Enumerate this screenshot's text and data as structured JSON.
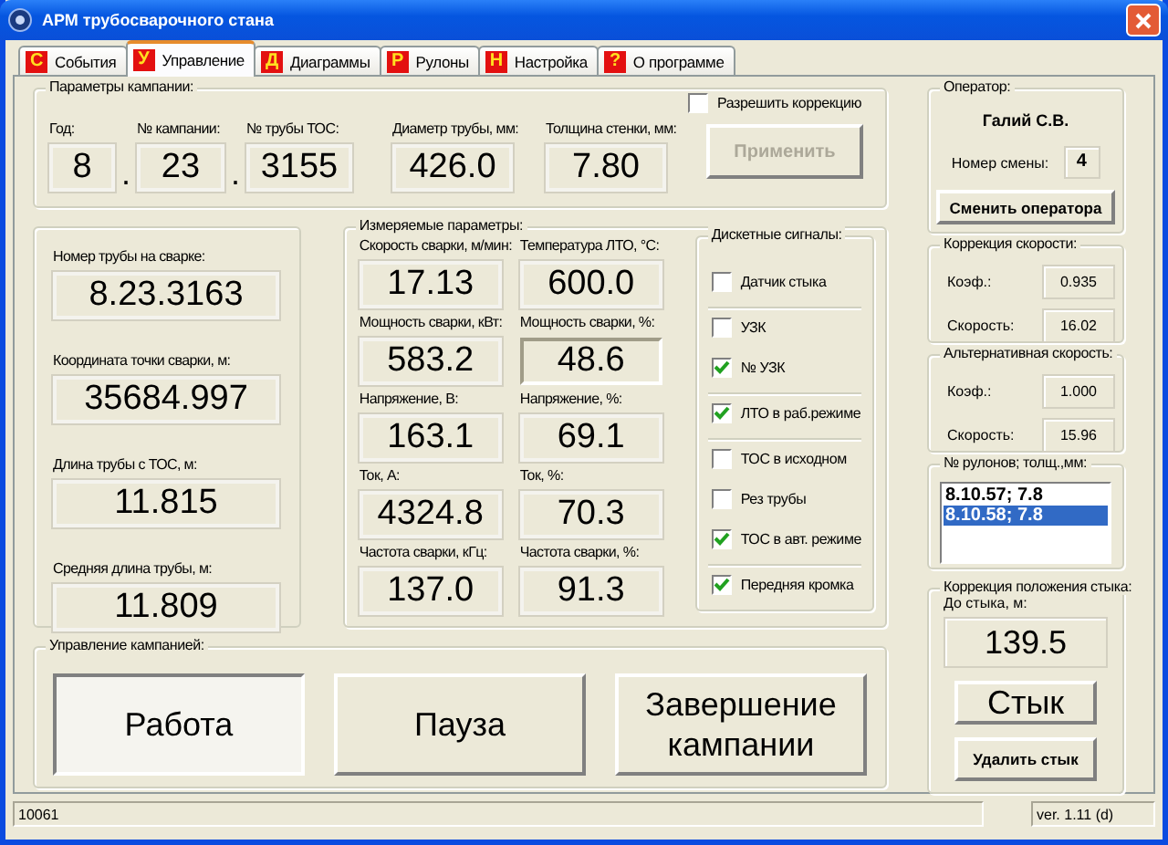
{
  "window": {
    "title": "АРМ трубосварочного стана"
  },
  "tabs": [
    {
      "icon": "С",
      "label": "События",
      "selected": false
    },
    {
      "icon": "У",
      "label": "Управление",
      "selected": true
    },
    {
      "icon": "Д",
      "label": "Диаграммы",
      "selected": false
    },
    {
      "icon": "Р",
      "label": "Рулоны",
      "selected": false
    },
    {
      "icon": "Н",
      "label": "Настройка",
      "selected": false
    },
    {
      "icon": "?",
      "label": "О программе",
      "selected": false
    }
  ],
  "campaign_params": {
    "title": "Параметры кампании:",
    "fields": [
      {
        "kind": "field",
        "label": "Год:",
        "value": "8"
      },
      {
        "kind": "separator",
        "value": "."
      },
      {
        "kind": "field",
        "label": "№ кампании:",
        "value": "23"
      },
      {
        "kind": "separator",
        "value": "."
      },
      {
        "kind": "field",
        "label": "№ трубы ТОС:",
        "value": "3155"
      },
      {
        "kind": "field",
        "label": "Диаметр трубы, мм:",
        "value": "426.0"
      },
      {
        "kind": "field",
        "label": "Толщина стенки, мм:",
        "value": "7.80"
      }
    ],
    "allow_correction": {
      "label": "Разрешить коррекцию",
      "checked": false
    },
    "apply_button": {
      "label": "Применить",
      "disabled": true
    }
  },
  "pipe_info": [
    {
      "label": "Номер трубы на сварке:",
      "value": "8.23.3163"
    },
    {
      "label": "Координата точки сварки, м:",
      "value": "35684.997"
    },
    {
      "label": "Длина трубы с ТОС, м:",
      "value": "11.815"
    },
    {
      "label": "Средняя длина трубы, м:",
      "value": "11.809"
    }
  ],
  "measured": {
    "title": "Измеряемые параметры:",
    "fields": [
      {
        "label": "Скорость сварки, м/мин:",
        "value": "17.13",
        "focused": false
      },
      {
        "label": "Температура ЛТО, °С:",
        "value": "600.0",
        "focused": false
      },
      {
        "label": "Мощность сварки, кВт:",
        "value": "583.2",
        "focused": false
      },
      {
        "label": "Мощность сварки, %:",
        "value": "48.6",
        "focused": true
      },
      {
        "label": "Напряжение, В:",
        "value": "163.1",
        "focused": false
      },
      {
        "label": "Напряжение, %:",
        "value": "69.1",
        "focused": false
      },
      {
        "label": "Ток, А:",
        "value": "4324.8",
        "focused": false
      },
      {
        "label": "Ток, %:",
        "value": "70.3",
        "focused": false
      },
      {
        "label": "Частота сварки, кГц:",
        "value": "137.0",
        "focused": false
      },
      {
        "label": "Частота сварки, %:",
        "value": "91.3",
        "focused": false
      }
    ]
  },
  "signals": {
    "title": "Дискетные сигналы:",
    "groups": [
      {
        "items": [
          {
            "label": "Датчик стыка",
            "checked": false
          }
        ]
      },
      {
        "items": [
          {
            "label": "УЗК",
            "checked": false
          },
          {
            "label": "№ УЗК",
            "checked": true
          }
        ]
      },
      {
        "items": [
          {
            "label": "ЛТО в раб.режиме",
            "checked": true
          }
        ]
      },
      {
        "items": [
          {
            "label": "ТОС в исходном",
            "checked": false
          },
          {
            "label": "Рез трубы",
            "checked": false
          },
          {
            "label": "ТОС в авт. режиме",
            "checked": true
          }
        ]
      },
      {
        "items": [
          {
            "label": "Передняя кромка",
            "checked": true
          }
        ]
      }
    ]
  },
  "campaign_control": {
    "title": "Управление кампанией:",
    "buttons": [
      {
        "label": "Работа",
        "selected": true
      },
      {
        "label": "Пауза",
        "selected": false
      },
      {
        "label": "Завершение кампании",
        "selected": false
      }
    ]
  },
  "operator": {
    "title": "Оператор:",
    "name": "Галий С.В.",
    "shift_label": "Номер смены:",
    "shift": "4",
    "button": "Сменить оператора"
  },
  "speed_correction": {
    "title": "Коррекция скорости:",
    "rows": [
      {
        "label": "Коэф.:",
        "value": "0.935"
      },
      {
        "label": "Скорость:",
        "value": "16.02"
      }
    ]
  },
  "alt_speed": {
    "title": "Альтернативная скорость:",
    "rows": [
      {
        "label": "Коэф.:",
        "value": "1.000"
      },
      {
        "label": "Скорость:",
        "value": "15.96"
      }
    ]
  },
  "rolls": {
    "title": "№ рулонов; толщ.,мм:",
    "items": [
      {
        "label": "8.10.57; 7.8",
        "selected": false
      },
      {
        "label": "8.10.58; 7.8",
        "selected": true
      }
    ]
  },
  "joint_correction": {
    "title": "Коррекция положения стыка:",
    "label": "До стыка, м:",
    "value": "139.5",
    "buttons": [
      {
        "kind": "large",
        "label": "Стык"
      },
      {
        "kind": "bold",
        "label": "Удалить стык"
      }
    ]
  },
  "status_bar": [
    "10061",
    "ver. 1.11 (d)"
  ]
}
